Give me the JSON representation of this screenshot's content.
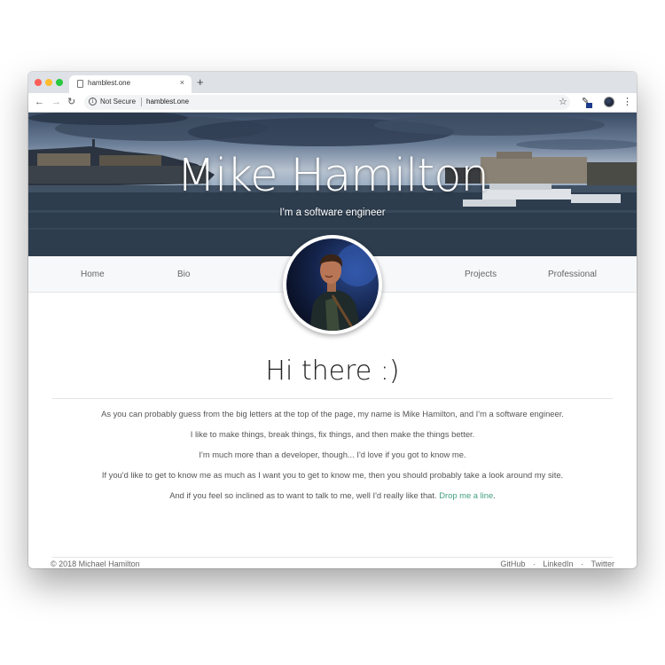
{
  "browser": {
    "tab_title": "hamblest.one",
    "tab_close": "×",
    "new_tab": "+",
    "security_label": "Not Secure",
    "url": "hamblest.one",
    "back_icon": "←",
    "forward_icon": "→",
    "reload_icon": "↻",
    "star_icon": "☆",
    "menu_icon": "⋮"
  },
  "hero": {
    "name": "Mike Hamilton",
    "subtitle": "I'm a software engineer"
  },
  "nav": {
    "items": [
      "Home",
      "Bio",
      "Projects",
      "Professional"
    ]
  },
  "content": {
    "greeting": "Hi there :)",
    "paragraphs": [
      "As you can probably guess from the big letters at the top of the page, my name is Mike Hamilton, and I'm a software engineer.",
      "I like to make things, break things, fix things, and then make the things better.",
      "I'm much more than a developer, though... I'd love if you got to know me.",
      "If you'd like to get to know me as much as I want you to get to know me, then you should probably take a look around my site."
    ],
    "last_paragraph_prefix": "And if you feel so inclined as to want to talk to me, well I'd really like that. ",
    "contact_link": "Drop me a line",
    "last_paragraph_suffix": "."
  },
  "footer": {
    "copyright": "© 2018 Michael Hamilton",
    "links": [
      "GitHub",
      "LinkedIn",
      "Twitter"
    ],
    "separator": "·"
  },
  "colors": {
    "accent": "#3f9f7a",
    "nav_bg": "#f7f8f9"
  }
}
